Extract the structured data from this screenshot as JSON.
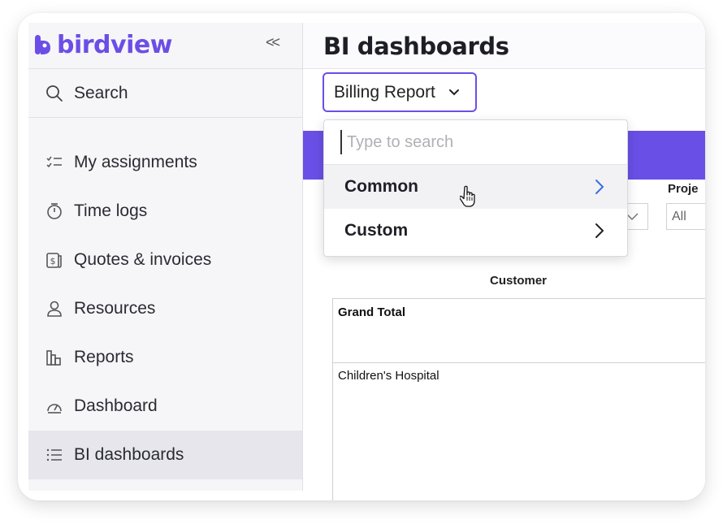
{
  "app": {
    "brand": "birdview",
    "brand_color": "#6c4ee6",
    "collapse_label": "<<"
  },
  "search": {
    "label": "Search"
  },
  "sidebar": {
    "items": [
      {
        "label": "My assignments",
        "icon": "checklist-icon"
      },
      {
        "label": "Time logs",
        "icon": "stopwatch-icon"
      },
      {
        "label": "Quotes & invoices",
        "icon": "invoice-icon"
      },
      {
        "label": "Resources",
        "icon": "person-icon"
      },
      {
        "label": "Reports",
        "icon": "bar-chart-icon"
      },
      {
        "label": "Dashboard",
        "icon": "gauge-icon"
      },
      {
        "label": "BI dashboards",
        "icon": "list-icon",
        "active": true
      }
    ]
  },
  "main": {
    "title": "BI dashboards",
    "report_select": {
      "value": "Billing Report"
    },
    "banner_color": "#6a4fe6",
    "project_filter": {
      "label": "Proje",
      "value": "All"
    },
    "table": {
      "column_header": "Customer",
      "rows": [
        "Grand Total",
        "Children's Hospital"
      ]
    }
  },
  "dropdown": {
    "search_placeholder": "Type to search",
    "items": [
      {
        "label": "Common",
        "hovered": true,
        "arrow_color": "#3b6fe0"
      },
      {
        "label": "Custom",
        "hovered": false,
        "arrow_color": "#222222"
      }
    ]
  }
}
